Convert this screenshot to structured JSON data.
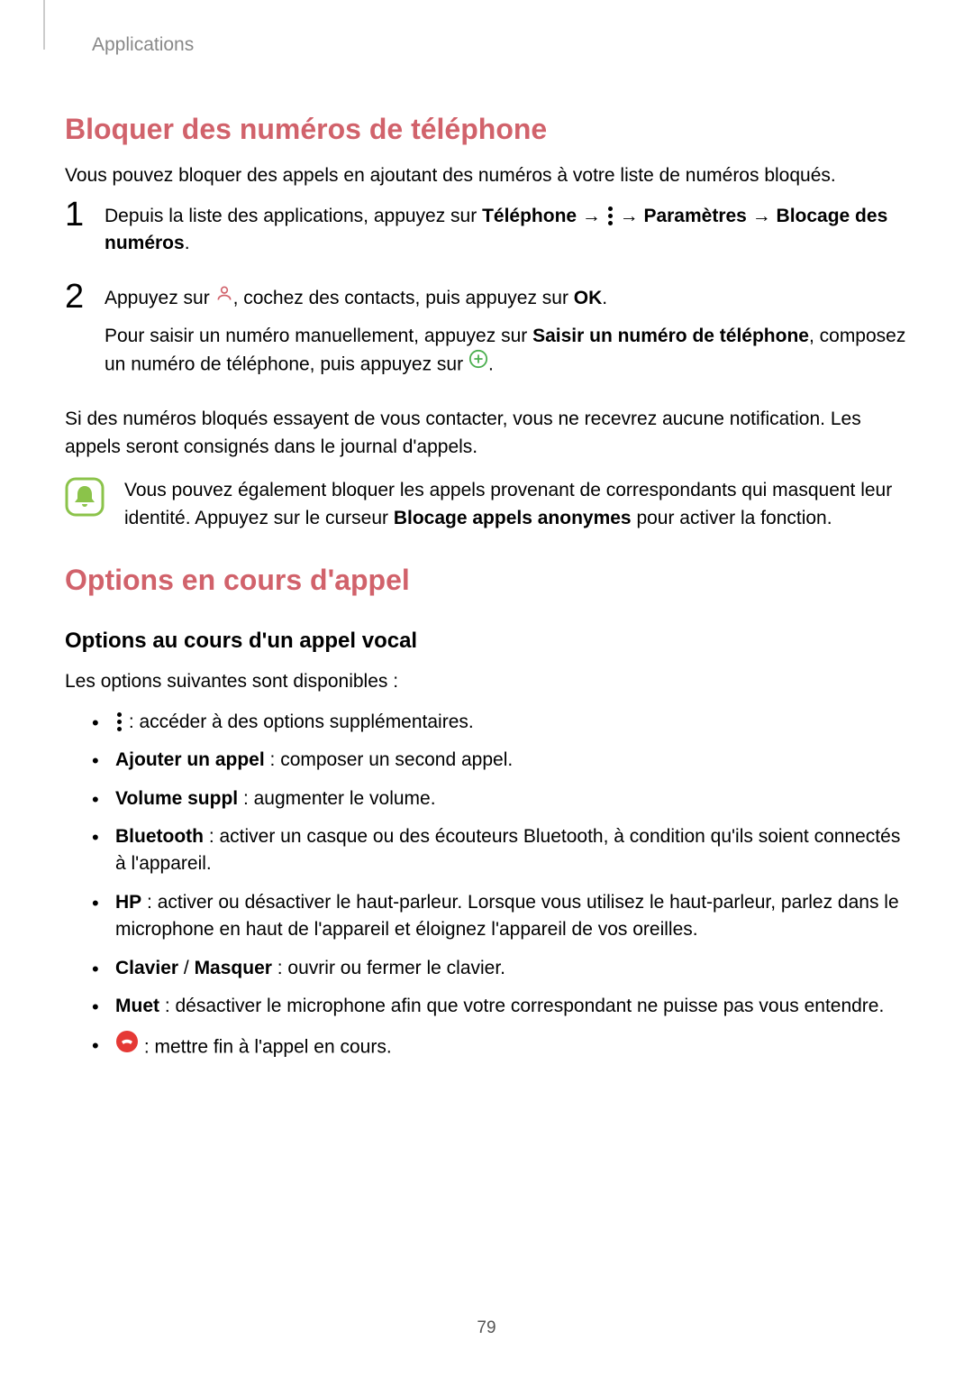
{
  "breadcrumb": "Applications",
  "page_number": "79",
  "section1": {
    "heading": "Bloquer des numéros de téléphone",
    "intro": "Vous pouvez bloquer des appels en ajoutant des numéros à votre liste de numéros bloqués.",
    "step1": {
      "num": "1",
      "pre": "Depuis la liste des applications, appuyez sur ",
      "b1": "Téléphone",
      "arrow1": " → ",
      "arrow2": " → ",
      "b2": "Paramètres",
      "arrow3": " → ",
      "b3": "Blocage des numéros",
      "end": "."
    },
    "step2": {
      "num": "2",
      "line1_pre": "Appuyez sur ",
      "line1_mid": ", cochez des contacts, puis appuyez sur ",
      "line1_b": "OK",
      "line1_end": ".",
      "line2_pre": "Pour saisir un numéro manuellement, appuyez sur ",
      "line2_b": "Saisir un numéro de téléphone",
      "line2_mid": ", composez un numéro de téléphone, puis appuyez sur ",
      "line2_end": "."
    },
    "after": "Si des numéros bloqués essayent de vous contacter, vous ne recevrez aucune notification. Les appels seront consignés dans le journal d'appels.",
    "note_pre": "Vous pouvez également bloquer les appels provenant de correspondants qui masquent leur identité. Appuyez sur le curseur ",
    "note_b": "Blocage appels anonymes",
    "note_post": " pour activer la fonction."
  },
  "section2": {
    "heading": "Options en cours d'appel",
    "subheading": "Options au cours d'un appel vocal",
    "intro": "Les options suivantes sont disponibles :",
    "items": {
      "more": " : accéder à des options supplémentaires.",
      "add_b": "Ajouter un appel",
      "add_rest": " : composer un second appel.",
      "vol_b": "Volume suppl",
      "vol_rest": " : augmenter le volume.",
      "bt_b": "Bluetooth",
      "bt_rest": " : activer un casque ou des écouteurs Bluetooth, à condition qu'ils soient connectés à l'appareil.",
      "hp_b": "HP",
      "hp_rest": " : activer ou désactiver le haut-parleur. Lorsque vous utilisez le haut-parleur, parlez dans le microphone en haut de l'appareil et éloignez l'appareil de vos oreilles.",
      "kb_b1": "Clavier",
      "kb_sep": " / ",
      "kb_b2": "Masquer",
      "kb_rest": " : ouvrir ou fermer le clavier.",
      "mute_b": "Muet",
      "mute_rest": " : désactiver le microphone afin que votre correspondant ne puisse pas vous entendre.",
      "end_rest": " : mettre fin à l'appel en cours."
    }
  }
}
